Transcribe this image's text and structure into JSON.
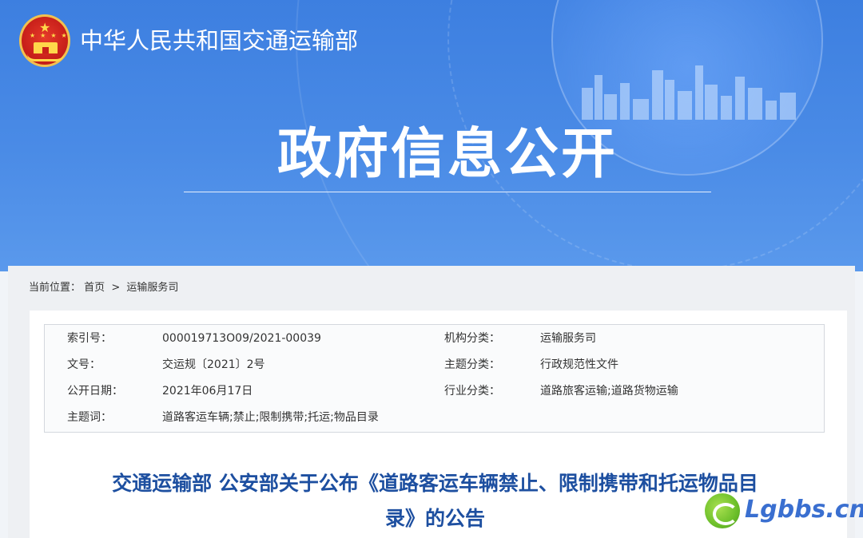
{
  "header": {
    "org_name": "中华人民共和国交通运输部",
    "section_title": "政府信息公开"
  },
  "breadcrumb": {
    "label": "当前位置：",
    "home": "首页",
    "separator": ">",
    "current": "运输服务司"
  },
  "meta": {
    "rows": [
      {
        "k1": "索引号：",
        "v1": "000019713O09/2021-00039",
        "k2": "机构分类：",
        "v2": "运输服务司"
      },
      {
        "k1": "文号：",
        "v1": "交运规〔2021〕2号",
        "k2": "主题分类：",
        "v2": "行政规范性文件"
      },
      {
        "k1": "公开日期：",
        "v1": "2021年06月17日",
        "k2": "行业分类：",
        "v2": "道路旅客运输;道路货物运输"
      },
      {
        "k1": "主题词：",
        "v1": "道路客运车辆;禁止;限制携带;托运;物品目录",
        "k2": "",
        "v2": ""
      }
    ]
  },
  "document": {
    "title_line1": "交通运输部 公安部关于公布《道路客运车辆禁止、限制携带和托运物品目",
    "title_line2": "录》的公告"
  },
  "watermark": {
    "text": "Lgbbs.cn",
    "icon": "lgbbs-logo-icon"
  },
  "icons": {
    "emblem": "national-emblem-icon",
    "skyline": "city-skyline-icon"
  },
  "colors": {
    "banner": "#3d7fe0",
    "title_text": "#1d4fa0",
    "watermark_text": "#3a6fd0",
    "watermark_logo": "#6cbf2a"
  }
}
